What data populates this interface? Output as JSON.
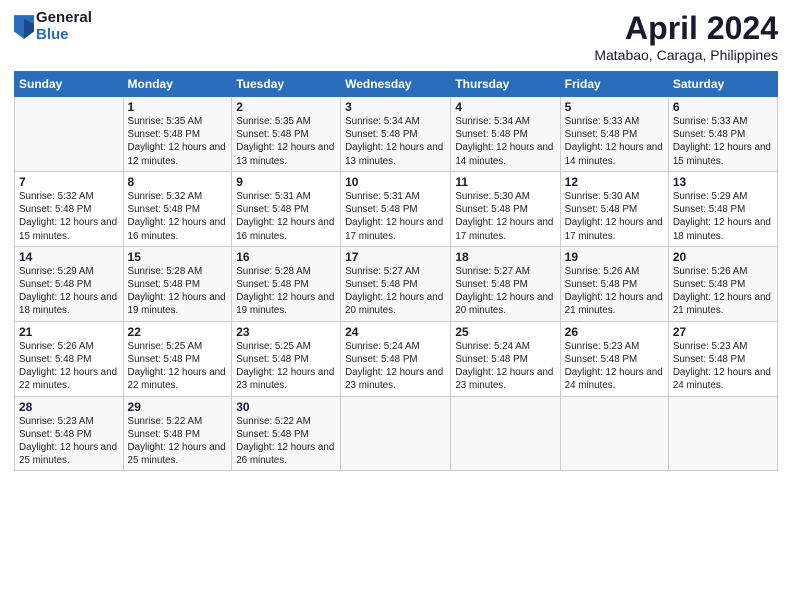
{
  "header": {
    "logo_general": "General",
    "logo_blue": "Blue",
    "title": "April 2024",
    "subtitle": "Matabao, Caraga, Philippines"
  },
  "calendar": {
    "days_header": [
      "Sunday",
      "Monday",
      "Tuesday",
      "Wednesday",
      "Thursday",
      "Friday",
      "Saturday"
    ],
    "weeks": [
      [
        {
          "day": "",
          "sunrise": "",
          "sunset": "",
          "daylight": ""
        },
        {
          "day": "1",
          "sunrise": "Sunrise: 5:35 AM",
          "sunset": "Sunset: 5:48 PM",
          "daylight": "Daylight: 12 hours and 12 minutes."
        },
        {
          "day": "2",
          "sunrise": "Sunrise: 5:35 AM",
          "sunset": "Sunset: 5:48 PM",
          "daylight": "Daylight: 12 hours and 13 minutes."
        },
        {
          "day": "3",
          "sunrise": "Sunrise: 5:34 AM",
          "sunset": "Sunset: 5:48 PM",
          "daylight": "Daylight: 12 hours and 13 minutes."
        },
        {
          "day": "4",
          "sunrise": "Sunrise: 5:34 AM",
          "sunset": "Sunset: 5:48 PM",
          "daylight": "Daylight: 12 hours and 14 minutes."
        },
        {
          "day": "5",
          "sunrise": "Sunrise: 5:33 AM",
          "sunset": "Sunset: 5:48 PM",
          "daylight": "Daylight: 12 hours and 14 minutes."
        },
        {
          "day": "6",
          "sunrise": "Sunrise: 5:33 AM",
          "sunset": "Sunset: 5:48 PM",
          "daylight": "Daylight: 12 hours and 15 minutes."
        }
      ],
      [
        {
          "day": "7",
          "sunrise": "Sunrise: 5:32 AM",
          "sunset": "Sunset: 5:48 PM",
          "daylight": "Daylight: 12 hours and 15 minutes."
        },
        {
          "day": "8",
          "sunrise": "Sunrise: 5:32 AM",
          "sunset": "Sunset: 5:48 PM",
          "daylight": "Daylight: 12 hours and 16 minutes."
        },
        {
          "day": "9",
          "sunrise": "Sunrise: 5:31 AM",
          "sunset": "Sunset: 5:48 PM",
          "daylight": "Daylight: 12 hours and 16 minutes."
        },
        {
          "day": "10",
          "sunrise": "Sunrise: 5:31 AM",
          "sunset": "Sunset: 5:48 PM",
          "daylight": "Daylight: 12 hours and 17 minutes."
        },
        {
          "day": "11",
          "sunrise": "Sunrise: 5:30 AM",
          "sunset": "Sunset: 5:48 PM",
          "daylight": "Daylight: 12 hours and 17 minutes."
        },
        {
          "day": "12",
          "sunrise": "Sunrise: 5:30 AM",
          "sunset": "Sunset: 5:48 PM",
          "daylight": "Daylight: 12 hours and 17 minutes."
        },
        {
          "day": "13",
          "sunrise": "Sunrise: 5:29 AM",
          "sunset": "Sunset: 5:48 PM",
          "daylight": "Daylight: 12 hours and 18 minutes."
        }
      ],
      [
        {
          "day": "14",
          "sunrise": "Sunrise: 5:29 AM",
          "sunset": "Sunset: 5:48 PM",
          "daylight": "Daylight: 12 hours and 18 minutes."
        },
        {
          "day": "15",
          "sunrise": "Sunrise: 5:28 AM",
          "sunset": "Sunset: 5:48 PM",
          "daylight": "Daylight: 12 hours and 19 minutes."
        },
        {
          "day": "16",
          "sunrise": "Sunrise: 5:28 AM",
          "sunset": "Sunset: 5:48 PM",
          "daylight": "Daylight: 12 hours and 19 minutes."
        },
        {
          "day": "17",
          "sunrise": "Sunrise: 5:27 AM",
          "sunset": "Sunset: 5:48 PM",
          "daylight": "Daylight: 12 hours and 20 minutes."
        },
        {
          "day": "18",
          "sunrise": "Sunrise: 5:27 AM",
          "sunset": "Sunset: 5:48 PM",
          "daylight": "Daylight: 12 hours and 20 minutes."
        },
        {
          "day": "19",
          "sunrise": "Sunrise: 5:26 AM",
          "sunset": "Sunset: 5:48 PM",
          "daylight": "Daylight: 12 hours and 21 minutes."
        },
        {
          "day": "20",
          "sunrise": "Sunrise: 5:26 AM",
          "sunset": "Sunset: 5:48 PM",
          "daylight": "Daylight: 12 hours and 21 minutes."
        }
      ],
      [
        {
          "day": "21",
          "sunrise": "Sunrise: 5:26 AM",
          "sunset": "Sunset: 5:48 PM",
          "daylight": "Daylight: 12 hours and 22 minutes."
        },
        {
          "day": "22",
          "sunrise": "Sunrise: 5:25 AM",
          "sunset": "Sunset: 5:48 PM",
          "daylight": "Daylight: 12 hours and 22 minutes."
        },
        {
          "day": "23",
          "sunrise": "Sunrise: 5:25 AM",
          "sunset": "Sunset: 5:48 PM",
          "daylight": "Daylight: 12 hours and 23 minutes."
        },
        {
          "day": "24",
          "sunrise": "Sunrise: 5:24 AM",
          "sunset": "Sunset: 5:48 PM",
          "daylight": "Daylight: 12 hours and 23 minutes."
        },
        {
          "day": "25",
          "sunrise": "Sunrise: 5:24 AM",
          "sunset": "Sunset: 5:48 PM",
          "daylight": "Daylight: 12 hours and 23 minutes."
        },
        {
          "day": "26",
          "sunrise": "Sunrise: 5:23 AM",
          "sunset": "Sunset: 5:48 PM",
          "daylight": "Daylight: 12 hours and 24 minutes."
        },
        {
          "day": "27",
          "sunrise": "Sunrise: 5:23 AM",
          "sunset": "Sunset: 5:48 PM",
          "daylight": "Daylight: 12 hours and 24 minutes."
        }
      ],
      [
        {
          "day": "28",
          "sunrise": "Sunrise: 5:23 AM",
          "sunset": "Sunset: 5:48 PM",
          "daylight": "Daylight: 12 hours and 25 minutes."
        },
        {
          "day": "29",
          "sunrise": "Sunrise: 5:22 AM",
          "sunset": "Sunset: 5:48 PM",
          "daylight": "Daylight: 12 hours and 25 minutes."
        },
        {
          "day": "30",
          "sunrise": "Sunrise: 5:22 AM",
          "sunset": "Sunset: 5:48 PM",
          "daylight": "Daylight: 12 hours and 26 minutes."
        },
        {
          "day": "",
          "sunrise": "",
          "sunset": "",
          "daylight": ""
        },
        {
          "day": "",
          "sunrise": "",
          "sunset": "",
          "daylight": ""
        },
        {
          "day": "",
          "sunrise": "",
          "sunset": "",
          "daylight": ""
        },
        {
          "day": "",
          "sunrise": "",
          "sunset": "",
          "daylight": ""
        }
      ]
    ]
  }
}
